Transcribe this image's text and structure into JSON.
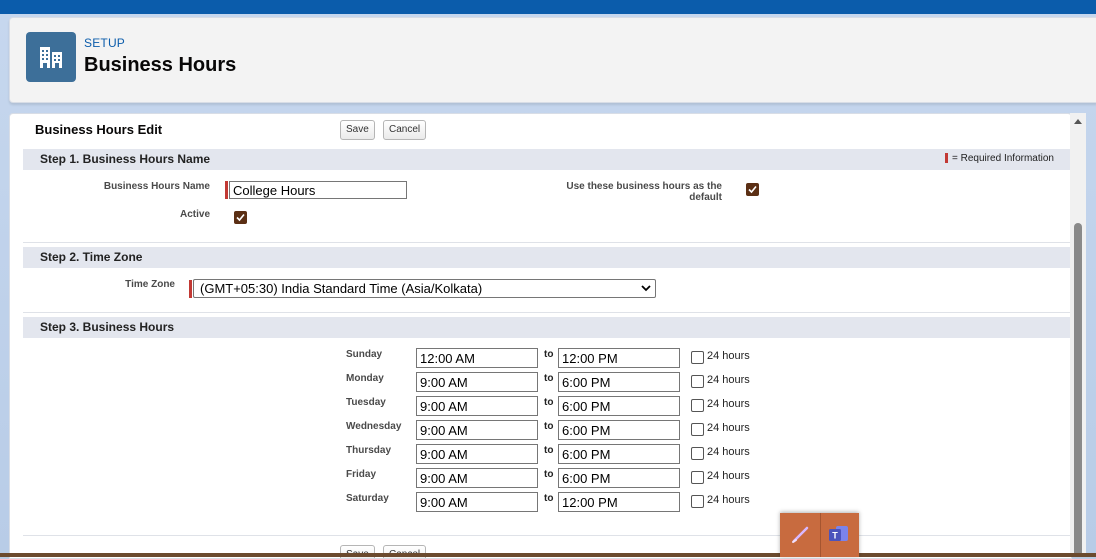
{
  "header": {
    "eyebrow": "SETUP",
    "title": "Business Hours",
    "icon": "building-icon"
  },
  "form": {
    "edit_title": "Business Hours Edit",
    "save_label": "Save",
    "cancel_label": "Cancel",
    "required_info": "= Required Information",
    "step1": {
      "title": "Step 1. Business Hours Name",
      "name_label": "Business Hours Name",
      "name_value": "College Hours",
      "active_label": "Active",
      "active_checked": true,
      "default_label_line1": "Use these business hours as the",
      "default_label_line2": "default",
      "default_checked": true
    },
    "step2": {
      "title": "Step 2. Time Zone",
      "tz_label": "Time Zone",
      "tz_value": "(GMT+05:30) India Standard Time (Asia/Kolkata)"
    },
    "step3": {
      "title": "Step 3. Business Hours",
      "to_label": "to",
      "h24_label": "24 hours",
      "days": [
        {
          "day": "Sunday",
          "start": "12:00 AM",
          "end": "12:00 PM",
          "h24": false
        },
        {
          "day": "Monday",
          "start": "9:00 AM",
          "end": "6:00 PM",
          "h24": false
        },
        {
          "day": "Tuesday",
          "start": "9:00 AM",
          "end": "6:00 PM",
          "h24": false
        },
        {
          "day": "Wednesday",
          "start": "9:00 AM",
          "end": "6:00 PM",
          "h24": false
        },
        {
          "day": "Thursday",
          "start": "9:00 AM",
          "end": "6:00 PM",
          "h24": false
        },
        {
          "day": "Friday",
          "start": "9:00 AM",
          "end": "6:00 PM",
          "h24": false
        },
        {
          "day": "Saturday",
          "start": "9:00 AM",
          "end": "12:00 PM",
          "h24": false
        }
      ]
    }
  },
  "taskbar": {
    "icons": [
      "pen-app-icon",
      "teams-icon"
    ]
  },
  "colors": {
    "brand": "#0b5cab",
    "checkbox": "#5b2f14",
    "required": "#c23934"
  }
}
